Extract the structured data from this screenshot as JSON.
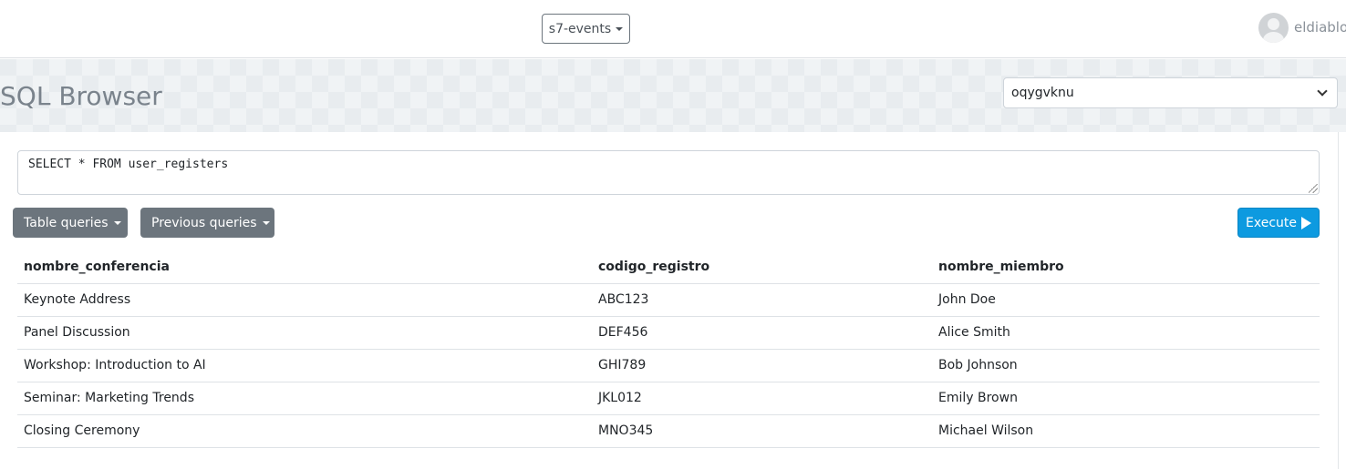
{
  "navbar": {
    "project_selector": "s7-events",
    "username": "eldiablo"
  },
  "header": {
    "title": "SQL Browser",
    "database_select": "oqygvknu"
  },
  "query": {
    "text": "SELECT * FROM user_registers"
  },
  "toolbar": {
    "table_queries_label": "Table queries",
    "previous_queries_label": "Previous queries",
    "execute_label": "Execute"
  },
  "results": {
    "columns": [
      "nombre_conferencia",
      "codigo_registro",
      "nombre_miembro"
    ],
    "rows": [
      [
        "Keynote Address",
        "ABC123",
        "John Doe"
      ],
      [
        "Panel Discussion",
        "DEF456",
        "Alice Smith"
      ],
      [
        "Workshop: Introduction to AI",
        "GHI789",
        "Bob Johnson"
      ],
      [
        "Seminar: Marketing Trends",
        "JKL012",
        "Emily Brown"
      ],
      [
        "Closing Ceremony",
        "MNO345",
        "Michael Wilson"
      ]
    ]
  },
  "icons": {
    "user_avatar": "user-avatar-icon",
    "dropdown": "caret-down-icon",
    "select": "chevron-down-icon",
    "execute": "play-icon"
  },
  "colors": {
    "execute_button": "#0d9ae0",
    "secondary_button": "#6c757d",
    "title_text": "#7a838c"
  }
}
